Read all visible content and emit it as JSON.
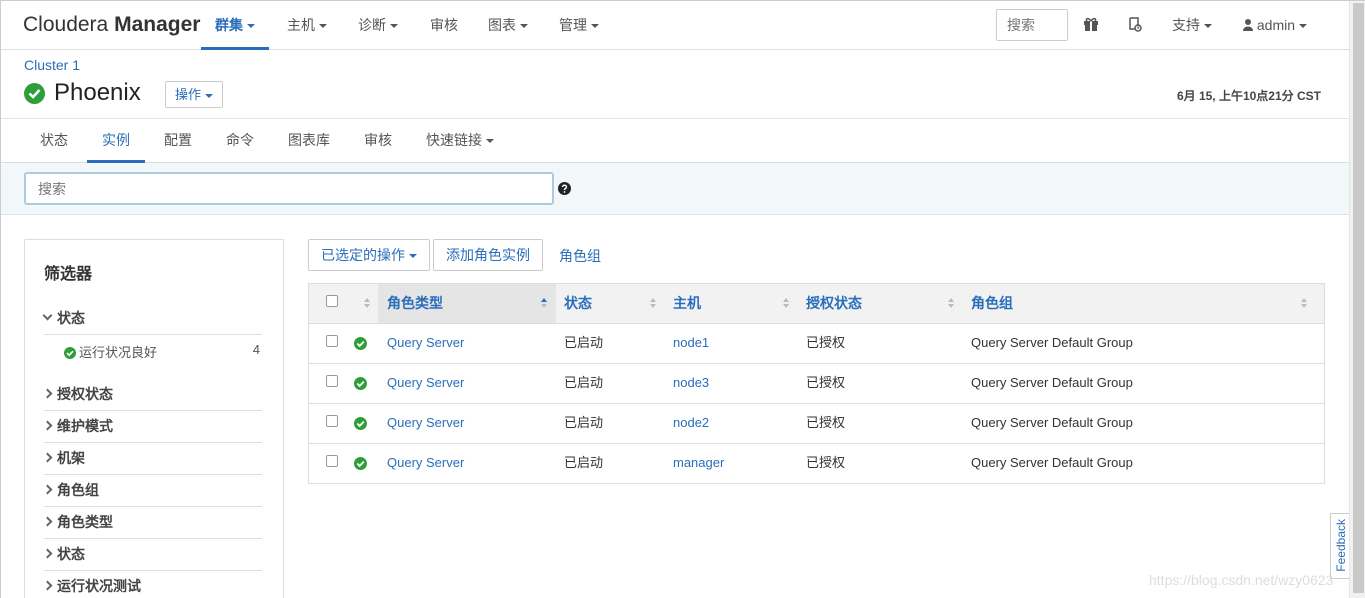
{
  "app": {
    "logo_light": "Cloudera",
    "logo_bold": "Manager"
  },
  "topnav": {
    "items": [
      "群集",
      "主机",
      "诊断",
      "审核",
      "图表",
      "管理"
    ],
    "search_placeholder": "搜索",
    "support": "支持",
    "user": "admin"
  },
  "header": {
    "cluster": "Cluster 1",
    "service": "Phoenix",
    "ops_button": "操作",
    "timestamp": "6月 15, 上午10点21分 CST"
  },
  "tabs": [
    "状态",
    "实例",
    "配置",
    "命令",
    "图表库",
    "审核",
    "快速链接"
  ],
  "search": {
    "placeholder": "搜索"
  },
  "filters": {
    "title": "筛选器",
    "status_section": "状态",
    "status_item": "运行状况良好",
    "status_count": "4",
    "sections": [
      "授权状态",
      "维护模式",
      "机架",
      "角色组",
      "角色类型",
      "状态",
      "运行状况测试"
    ]
  },
  "actions": {
    "selected_ops": "已选定的操作",
    "add_role": "添加角色实例",
    "role_groups": "角色组"
  },
  "table": {
    "columns": [
      "角色类型",
      "状态",
      "主机",
      "授权状态",
      "角色组"
    ],
    "rows": [
      {
        "role_type": "Query Server",
        "state": "已启动",
        "host": "node1",
        "auth": "已授权",
        "group": "Query Server Default Group"
      },
      {
        "role_type": "Query Server",
        "state": "已启动",
        "host": "node3",
        "auth": "已授权",
        "group": "Query Server Default Group"
      },
      {
        "role_type": "Query Server",
        "state": "已启动",
        "host": "node2",
        "auth": "已授权",
        "group": "Query Server Default Group"
      },
      {
        "role_type": "Query Server",
        "state": "已启动",
        "host": "manager",
        "auth": "已授权",
        "group": "Query Server Default Group"
      }
    ]
  },
  "feedback": "Feedback",
  "watermark": "https://blog.csdn.net/wzy0623",
  "colors": {
    "accent": "#2a6ebb",
    "ok": "#2e9e3b"
  }
}
